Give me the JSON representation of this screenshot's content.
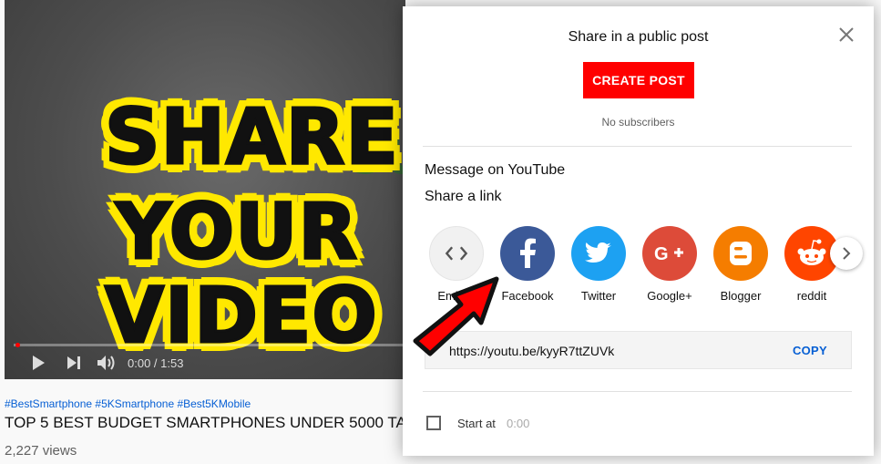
{
  "video": {
    "thumbnail_lines": [
      "SHARE",
      "YOUR",
      "VIDEO"
    ],
    "time": "0:00 / 1:53",
    "hashtags": "#BestSmartphone #5KSmartphone #Best5KMobile",
    "title": "TOP 5 BEST BUDGET SMARTPHONES UNDER 5000 TA",
    "views": "2,227 views"
  },
  "dialog": {
    "title": "Share in a public post",
    "create_post": "CREATE POST",
    "no_subscribers": "No subscribers",
    "message_youtube": "Message on YouTube",
    "share_link": "Share a link",
    "share_targets": [
      {
        "label": "Embed",
        "color": "#f1f1f1"
      },
      {
        "label": "Facebook",
        "color": "#3b5998"
      },
      {
        "label": "Twitter",
        "color": "#1da1f2"
      },
      {
        "label": "Google+",
        "color": "#dd4b39"
      },
      {
        "label": "Blogger",
        "color": "#f57d00"
      },
      {
        "label": "reddit",
        "color": "#ff4500"
      }
    ],
    "url": "https://youtu.be/kyyR7ttZUVk",
    "copy": "COPY",
    "start_at": "Start at",
    "start_time": "0:00"
  }
}
